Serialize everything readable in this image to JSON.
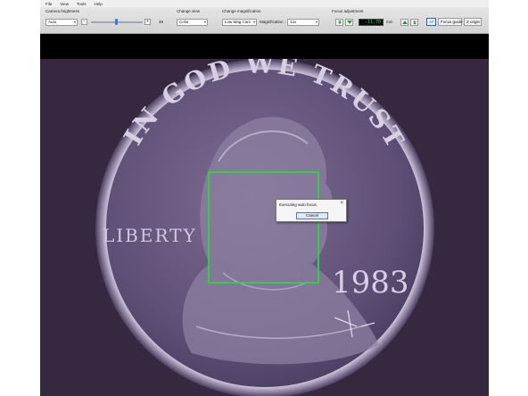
{
  "menu": [
    "File",
    "View",
    "Tools",
    "Help"
  ],
  "camera_brightness": {
    "label": "Camera brightness",
    "mode": "Auto",
    "minus": "-",
    "plus": "+",
    "value": "49",
    "slider_level": 0.49
  },
  "change_view": {
    "label": "Change view",
    "value": "Color"
  },
  "change_magnification": {
    "label": "Change magnification",
    "camera": "Low Mag Cam",
    "magnification_label": "Magnification :",
    "magnification": "12x"
  },
  "focus_adjustment": {
    "label": "Focus adjustment",
    "value": "-11.70",
    "unit": "mm",
    "af_label": "AF",
    "focus_guide_label": "Focus guide",
    "z_origin_label": "Z origin"
  },
  "coin": {
    "motto": "IN GOD WE TRUST",
    "liberty": "LIBERTY",
    "year": "1983"
  },
  "dialog": {
    "message": "Executing auto focus.",
    "close": "×",
    "cancel_label": "Cancel"
  },
  "colors": {
    "viewport_bg": "#35283f",
    "focus_box": "#2ed13f",
    "lcd_text": "#2bd64a",
    "coin_base": "#6f5e86"
  }
}
